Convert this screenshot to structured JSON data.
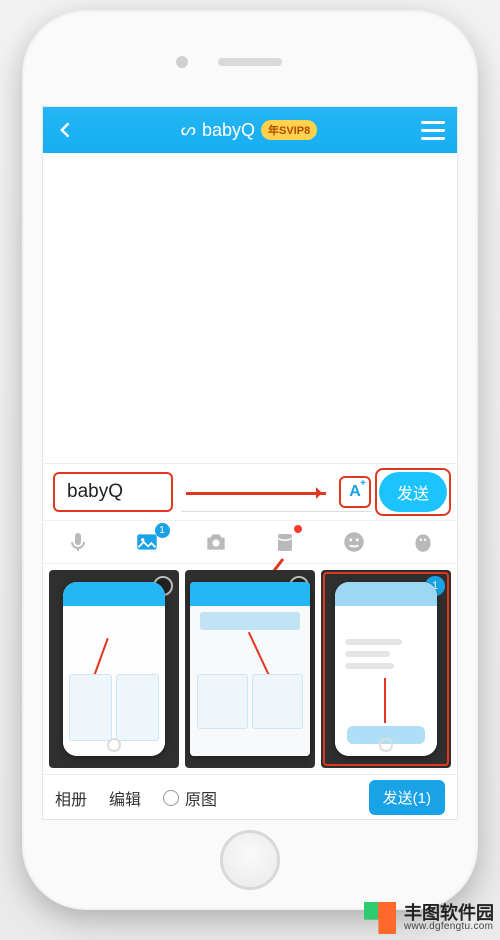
{
  "header": {
    "title": "babyQ",
    "badge": "SVIP8",
    "badge_prefix": "年"
  },
  "input": {
    "text": "babyQ",
    "font_icon_label": "A",
    "send_label": "发送"
  },
  "toolbar": {
    "photo_badge": "1"
  },
  "gallery": {
    "selected_index_label": "1"
  },
  "actions": {
    "album": "相册",
    "edit": "编辑",
    "original": "原图",
    "send_with_count": "发送(1)"
  },
  "watermark": {
    "name": "丰图软件园",
    "url": "www.dgfengtu.com"
  },
  "colors": {
    "accent": "#1aa2e6",
    "highlight": "#e0381e"
  }
}
